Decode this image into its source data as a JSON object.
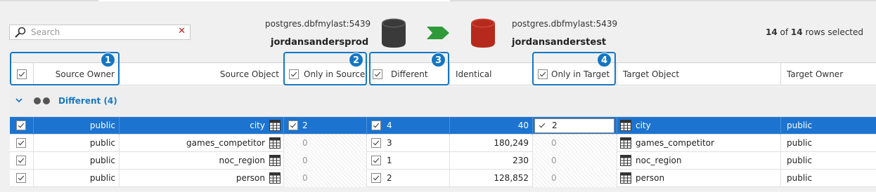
{
  "search": {
    "placeholder": "Search",
    "clear_icon": "clear-x-icon"
  },
  "source": {
    "server": "postgres.dbfmylast:5439",
    "database": "jordansandersprod",
    "color": "#3a3a3a"
  },
  "target": {
    "server": "postgres.dbfmylast:5439",
    "database": "jordansanderstest",
    "color": "#b52a1c"
  },
  "rows_selected": {
    "count": "14",
    "of_label": "of",
    "total": "14",
    "suffix": "rows selected"
  },
  "columns": {
    "source_owner": "Source Owner",
    "source_object": "Source Object",
    "only_in_source": "Only in Source",
    "different": "Different",
    "identical": "Identical",
    "only_in_target": "Only in Target",
    "target_object": "Target Object",
    "target_owner": "Target Owner"
  },
  "callouts": [
    "1",
    "2",
    "3",
    "4"
  ],
  "group": {
    "label": "Different (4)"
  },
  "rows": [
    {
      "source_owner": "public",
      "source_object": "city",
      "only_in_source": "2",
      "different": "4",
      "identical": "40",
      "only_in_target": "2",
      "target_object": "city",
      "target_owner": "public",
      "selected": true
    },
    {
      "source_owner": "public",
      "source_object": "games_competitor",
      "only_in_source": "0",
      "different": "3",
      "identical": "180,249",
      "only_in_target": "0",
      "target_object": "games_competitor",
      "target_owner": "public",
      "selected": false
    },
    {
      "source_owner": "public",
      "source_object": "noc_region",
      "only_in_source": "0",
      "different": "1",
      "identical": "230",
      "only_in_target": "0",
      "target_object": "noc_region",
      "target_owner": "public",
      "selected": false
    },
    {
      "source_owner": "public",
      "source_object": "person",
      "only_in_source": "0",
      "different": "2",
      "identical": "128,852",
      "only_in_target": "0",
      "target_object": "person",
      "target_owner": "public",
      "selected": false
    }
  ]
}
